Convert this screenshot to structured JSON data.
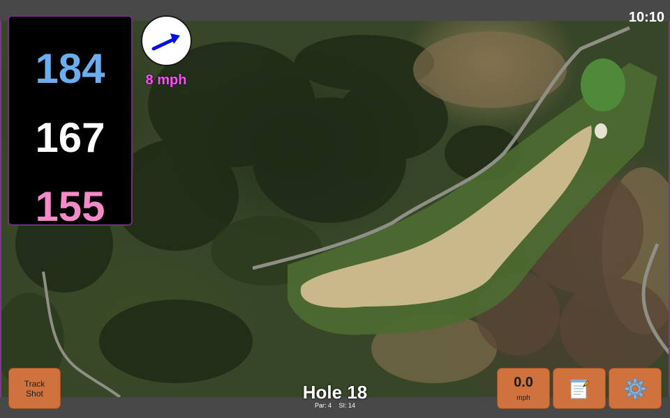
{
  "status": {
    "time": "10:10"
  },
  "distances": {
    "back": "184",
    "middle": "167",
    "front": "155"
  },
  "wind": {
    "speed_label": "8 mph",
    "direction_icon": "arrow-icon",
    "arrow_color": "#0010e0"
  },
  "hole": {
    "title": "Hole 18",
    "par_label": "Par: 4",
    "si_label": "SI: 14"
  },
  "buttons": {
    "track_shot_line1": "Track",
    "track_shot_line2": "Shot",
    "speed_value": "0.0",
    "speed_unit": "mph",
    "notes_icon": "notepad-icon",
    "settings_icon": "gear-icon"
  },
  "colors": {
    "back_distance": "#6aaef0",
    "middle_distance": "#ffffff",
    "front_distance": "#f48bc9",
    "wind_text": "#ff4cff",
    "button_bg": "#d0723e",
    "panel_border": "#6f2f83"
  }
}
